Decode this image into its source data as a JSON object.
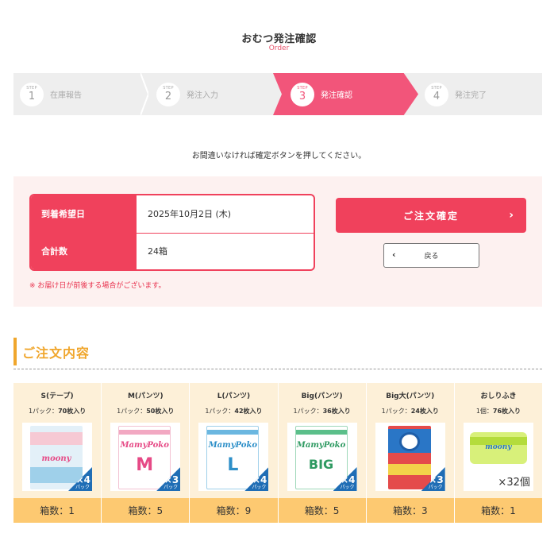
{
  "header": {
    "title": "おむつ発注確認",
    "subtitle": "Order"
  },
  "steps": [
    {
      "label": "STEP",
      "number": "1",
      "text": "在庫報告",
      "active": false
    },
    {
      "label": "STEP",
      "number": "2",
      "text": "発注入力",
      "active": false
    },
    {
      "label": "STEP",
      "number": "3",
      "text": "発注確認",
      "active": true
    },
    {
      "label": "STEP",
      "number": "4",
      "text": "発注完了",
      "active": false
    }
  ],
  "notice": "お間違いなければ確定ボタンを押してください。",
  "order_info": {
    "delivery_label": "到着希望日",
    "delivery_value": "2025年10月2日 (木)",
    "total_label": "合計数",
    "total_value": "24箱",
    "note": "※ お届け日が前後する場合がございます。"
  },
  "actions": {
    "confirm_label": "ご注文確定",
    "confirm_icon": "chevron-right-icon",
    "back_label": "戻る",
    "back_icon": "chevron-left-icon"
  },
  "section": {
    "title": "ご注文内容"
  },
  "products": [
    {
      "name": "S(テープ)",
      "pack_prefix": "1パック：",
      "pack_count": "70枚入り",
      "badge": "×4",
      "badge_unit": "パック",
      "boxes": "箱数：1"
    },
    {
      "name": "M(パンツ)",
      "pack_prefix": "1パック：",
      "pack_count": "50枚入り",
      "badge": "×3",
      "badge_unit": "パック",
      "boxes": "箱数：5"
    },
    {
      "name": "L(パンツ)",
      "pack_prefix": "1パック：",
      "pack_count": "42枚入り",
      "badge": "×4",
      "badge_unit": "パック",
      "boxes": "箱数：9"
    },
    {
      "name": "Big(パンツ)",
      "pack_prefix": "1パック：",
      "pack_count": "36枚入り",
      "badge": "×4",
      "badge_unit": "パック",
      "boxes": "箱数：5"
    },
    {
      "name": "Big大(パンツ)",
      "pack_prefix": "1パック：",
      "pack_count": "24枚入り",
      "badge": "×3",
      "badge_unit": "パック",
      "boxes": "箱数：3"
    },
    {
      "name": "おしりふき",
      "pack_prefix": "1個：",
      "pack_count": "76枚入り",
      "badge": "×32個",
      "badge_unit": "",
      "boxes": "箱数：1"
    }
  ],
  "colors": {
    "accent": "#f0415c",
    "step_active": "#f2557a",
    "section": "#f0a62c",
    "product_bg": "#fdf0d8",
    "box_bar": "#fdc971",
    "badge": "#1f6db5"
  }
}
